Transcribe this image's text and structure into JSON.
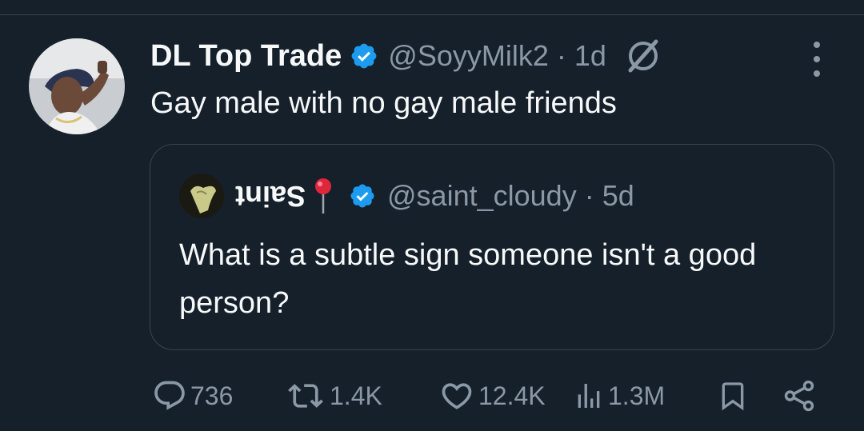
{
  "tweet": {
    "display_name": "DL Top Trade",
    "handle": "@SoyyMilk2",
    "separator": "·",
    "time": "1d",
    "text": "Gay male with no gay male friends",
    "verified_icon": "verified-badge-icon",
    "grok_icon": "grok-icon",
    "more_icon": "more-vertical-icon"
  },
  "quote": {
    "display_name": "Saint",
    "emoji": "📍",
    "handle": "@saint_cloudy",
    "separator": "·",
    "time": "5d",
    "text": "What is a subtle sign someone isn't a good person?"
  },
  "actions": {
    "replies": "736",
    "reposts": "1.4K",
    "likes": "12.4K",
    "views": "1.3M"
  },
  "colors": {
    "background": "#15202b",
    "text_primary": "#f7f9f9",
    "text_secondary": "#8b98a5",
    "verified": "#1d9bf0",
    "border": "#38444d"
  }
}
